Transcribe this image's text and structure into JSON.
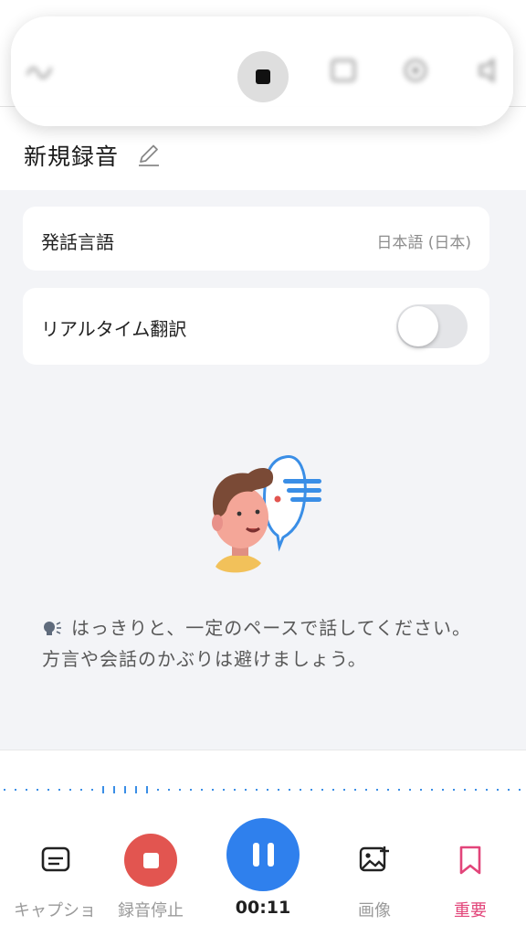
{
  "recording": {
    "title": "新規録音"
  },
  "settings": {
    "language_label": "発話言語",
    "language_value": "日本語 (日本)",
    "translation_label": "リアルタイム翻訳",
    "translation_enabled": false
  },
  "tip": {
    "text": "はっきりと、一定のペースで話してください。方言や会話のかぶりは避けましょう。"
  },
  "bottom_bar": {
    "caption_label": "キャプショ",
    "stop_label": "録音停止",
    "timer": "00:11",
    "image_label": "画像",
    "important_label": "重要"
  },
  "colors": {
    "accent_blue": "#2f80ed",
    "record_red": "#e25550",
    "important_pink": "#e2457a",
    "background": "#f3f4f7"
  },
  "icons": [
    "stop-icon",
    "edit-icon",
    "speaking-icon",
    "caption-icon",
    "image-add-icon",
    "bookmark-icon",
    "pause-icon"
  ]
}
